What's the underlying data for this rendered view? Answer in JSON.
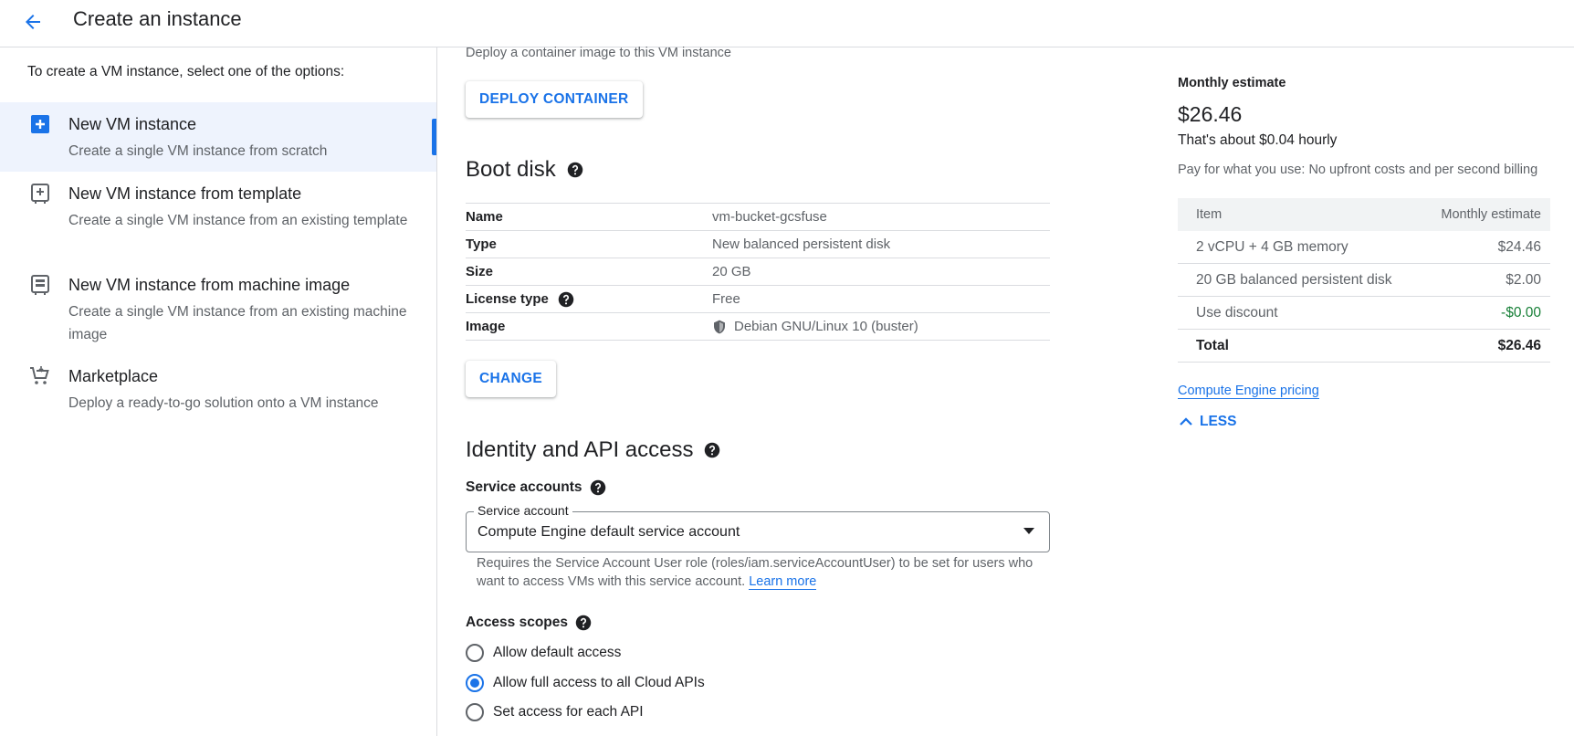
{
  "header": {
    "title": "Create an instance",
    "back_icon": "arrow-back-icon"
  },
  "left": {
    "intro": "To create a VM instance, select one of the options:",
    "options": [
      {
        "title": "New VM instance",
        "desc": "Create a single VM instance from scratch",
        "icon": "add-box-icon",
        "selected": true
      },
      {
        "title": "New VM instance from template",
        "desc": "Create a single VM instance from an existing template",
        "icon": "template-icon"
      },
      {
        "title": "New VM instance from machine image",
        "desc": "Create a single VM instance from an existing machine image",
        "icon": "machine-image-icon"
      },
      {
        "title": "Marketplace",
        "desc": "Deploy a ready-to-go solution onto a VM instance",
        "icon": "cart-icon"
      }
    ]
  },
  "container": {
    "desc": "Deploy a container image to this VM instance",
    "button": "DEPLOY CONTAINER"
  },
  "boot_disk": {
    "title": "Boot disk",
    "rows": [
      {
        "key": "Name",
        "value": "vm-bucket-gcsfuse"
      },
      {
        "key": "Type",
        "value": "New balanced persistent disk"
      },
      {
        "key": "Size",
        "value": "20 GB"
      },
      {
        "key": "License type",
        "value": "Free"
      },
      {
        "key": "Image",
        "value": "Debian GNU/Linux 10 (buster)"
      }
    ],
    "change_button": "CHANGE"
  },
  "identity": {
    "title": "Identity and API access",
    "service_accounts_label": "Service accounts",
    "service_account_legend": "Service account",
    "service_account_value": "Compute Engine default service account",
    "hint": "Requires the Service Account User role (roles/iam.serviceAccountUser) to be set for users who want to access VMs with this service account.",
    "learn_more": "Learn more",
    "access_scopes_label": "Access scopes",
    "scopes": [
      {
        "label": "Allow default access",
        "checked": false
      },
      {
        "label": "Allow full access to all Cloud APIs",
        "checked": true
      },
      {
        "label": "Set access for each API",
        "checked": false
      }
    ]
  },
  "estimate": {
    "label": "Monthly estimate",
    "amount": "$26.46",
    "hourly": "That's about $0.04 hourly",
    "note": "Pay for what you use: No upfront costs and per second billing",
    "head_item": "Item",
    "head_estimate": "Monthly estimate",
    "rows": [
      {
        "item": "2 vCPU + 4 GB memory",
        "cost": "$24.46"
      },
      {
        "item": "20 GB balanced persistent disk",
        "cost": "$2.00"
      },
      {
        "item": "Use discount",
        "cost": "-$0.00"
      },
      {
        "item": "Total",
        "cost": "$26.46"
      }
    ],
    "pricing_link": "Compute Engine pricing",
    "less": "LESS"
  },
  "colors": {
    "accent": "#1a73e8",
    "selected_bg": "#eef3fd",
    "discount": "#188038"
  }
}
